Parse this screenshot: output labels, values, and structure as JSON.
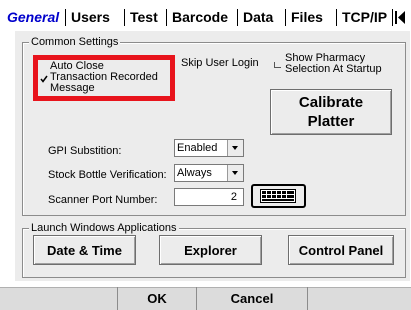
{
  "tabs": [
    {
      "label": "General",
      "active": true
    },
    {
      "label": "Users"
    },
    {
      "label": "Test"
    },
    {
      "label": "Barcode"
    },
    {
      "label": "Data"
    },
    {
      "label": "Files"
    },
    {
      "label": "TCP/IP"
    }
  ],
  "tab_scroll_left": "◀",
  "common_settings": {
    "title": "Common Settings",
    "auto_close": {
      "line1": "Auto Close",
      "line2": "Transaction Recorded",
      "line3": "Message",
      "checked": true
    },
    "skip_user_login": "Skip User Login",
    "show_pharmacy": {
      "line1": "Show Pharmacy",
      "line2": "Selection At Startup",
      "checked": false
    },
    "calibrate": {
      "line1": "Calibrate",
      "line2": "Platter"
    },
    "gpi": {
      "label": "GPI Substition:",
      "value": "Enabled"
    },
    "stock_bottle": {
      "label": "Stock Bottle Verification:",
      "value": "Always"
    },
    "scanner_port": {
      "label": "Scanner Port Number:",
      "value": "2"
    },
    "keyboard_icon": "keyboard-icon"
  },
  "launch": {
    "title": "Launch Windows Applications",
    "buttons": [
      "Date & Time",
      "Explorer",
      "Control Panel"
    ]
  },
  "footer": {
    "ok": "OK",
    "cancel": "Cancel"
  },
  "colors": {
    "panel": "#ececec",
    "highlight": "#e8141c",
    "active_tab": "#0000cc",
    "footer": "#dcdcdc"
  }
}
